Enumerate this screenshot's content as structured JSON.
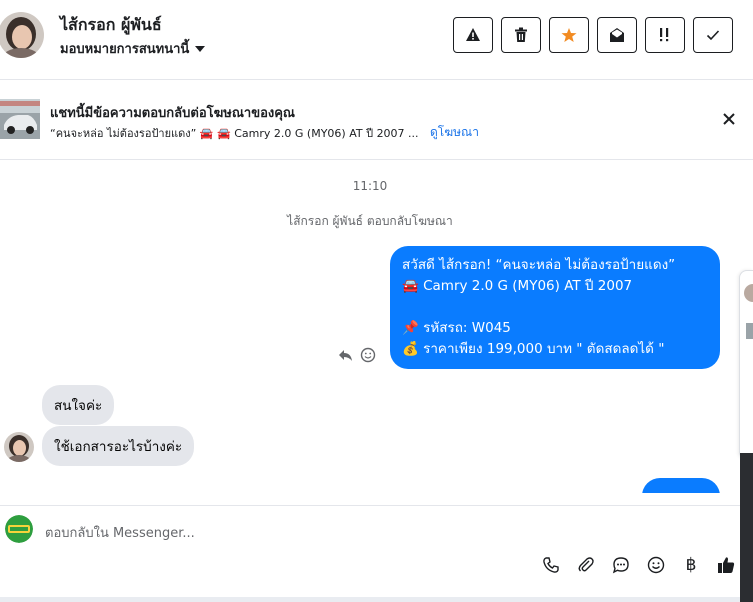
{
  "header": {
    "contact_name": "ไส้กรอก ผู้พันธ์",
    "assign_label": "มอบหมายการสนทนานี้"
  },
  "ad": {
    "title": "แชทนี้มีข้อความตอบกลับต่อโฆษณาของคุณ",
    "subtitle": "“คนจะหล่อ ไม่ต้องรอป้ายแดง” 🚘 🚘 Camry 2.0 G (MY06) AT ปี 2007 ...",
    "link": "ดูโฆษณา"
  },
  "chat": {
    "time": "11:10",
    "reply_note": "ไส้กรอก ผู้พันธ์ ตอบกลับโฆษณา",
    "outgoing": {
      "line1": "สวัสดี ไส้กรอก! “คนจะหล่อ ไม่ต้องรอป้ายแดง”",
      "line2": "🚘 Camry 2.0 G (MY06) AT ปี 2007",
      "line3": "📌 รหัสรถ: W045",
      "line4": "💰 ราคาเพียง 199,000 บาท \" ตัดสดลดได้ \""
    },
    "incoming": [
      {
        "text": "สนใจค่ะ"
      },
      {
        "text": "ใช้เอกสารอะไรบ้างค่ะ"
      }
    ]
  },
  "composer": {
    "placeholder": "ตอบกลับใน Messenger...",
    "baht_symbol": "฿"
  },
  "colors": {
    "outgoing_bubble": "#0a7cff",
    "incoming_bubble": "#e4e6eb",
    "link": "#1a73e8",
    "star": "#f28b22"
  }
}
